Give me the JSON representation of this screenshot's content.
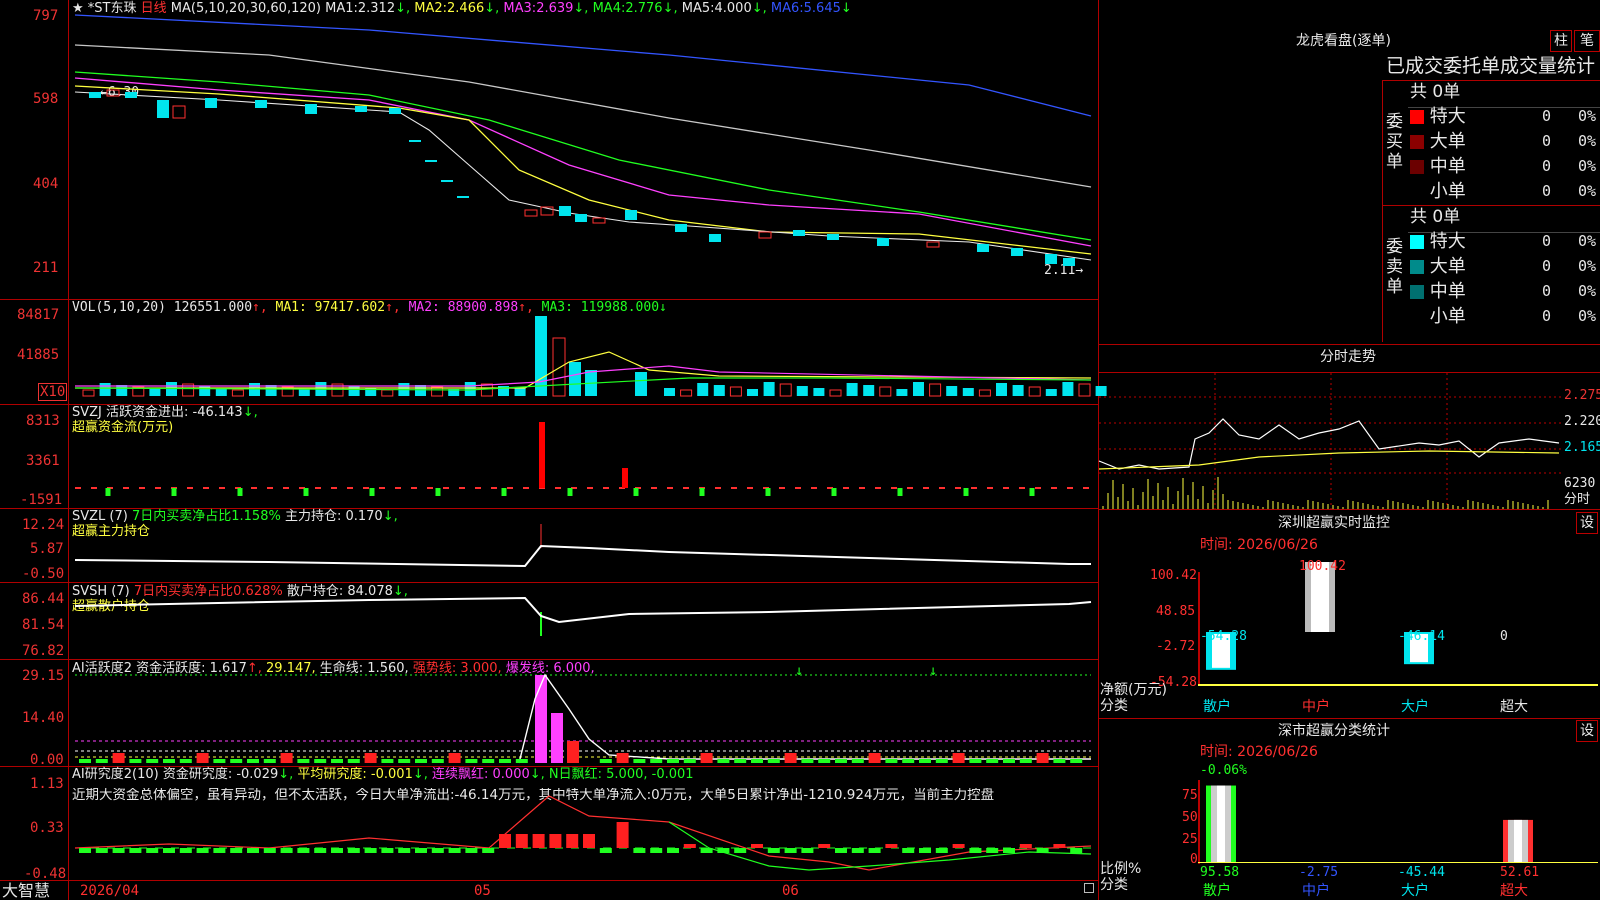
{
  "left_axis": {
    "price": [
      "797",
      "598",
      "404",
      "211"
    ],
    "vol": [
      "84817",
      "41885",
      "X10"
    ],
    "svzj": [
      "8313",
      "3361",
      "-1591"
    ],
    "svzl": [
      "12.24",
      "5.87",
      "-0.50"
    ],
    "svsh": [
      "86.44",
      "81.54",
      "76.82"
    ],
    "ai1": [
      "29.15",
      "14.40",
      "0.00"
    ],
    "ai2": [
      "1.13",
      "0.33",
      "-0.48"
    ]
  },
  "header": {
    "star": "★",
    "name": "*ST东珠",
    "period": "日线",
    "ma_label": "MA(5,10,20,30,60,120)",
    "ma": [
      {
        "label": "MA1:",
        "value": "2.312",
        "color": "#e8e8e8"
      },
      {
        "label": "MA2:",
        "value": "2.466",
        "color": "#ffff40"
      },
      {
        "label": "MA3:",
        "value": "2.639",
        "color": "#ff40ff"
      },
      {
        "label": "MA4:",
        "value": "2.776",
        "color": "#20ff20"
      },
      {
        "label": "MA5:",
        "value": "4.000",
        "color": "#e8e8e8"
      },
      {
        "label": "MA6:",
        "value": "5.645",
        "color": "#3355ff"
      }
    ],
    "high_mark": "6.30",
    "low_mark": "2.11"
  },
  "vol": {
    "label": "VOL(5,10,20)",
    "value": "126551.000",
    "ma1": "MA1: 97417.602",
    "ma2": "MA2: 88900.898",
    "ma3": "MA3: 119988.000"
  },
  "svzj": {
    "label": "SVZJ  活跃资金进出: -46.143",
    "sub": "超赢资金流(万元)"
  },
  "svzl": {
    "label": "SVZL (7)",
    "pct": "7日内买卖净占比1.158%",
    "hold": "主力持仓: 0.170",
    "sub": "超赢主力持仓"
  },
  "svsh": {
    "label": "SVSH (7)",
    "pct": "7日内买卖净占比0.628%",
    "hold": "散户持仓: 84.078",
    "sub": "超赢散户持仓"
  },
  "ai1": {
    "label": "AI活跃度2 资金活跃度: 1.617",
    "v2": "29.147,",
    "v3": "生命线: 1.560,",
    "v4": "强势线: 3.000,",
    "v5": "爆发线: 6.000,"
  },
  "ai2": {
    "label": "AI研究度2(10) 资金研究度: -0.029",
    "v2": "平均研究度: -0.001",
    "v3": "连续飘红: 0.000",
    "v4": "N日飘红: 5.000, -0.001",
    "text": "近期大资金总体偏空，虽有异动，但不太活跃，今日大单净流出:-46.14万元，其中特大单净流入:0万元，大单5日累计净出-1210.924万元，当前主力控盘"
  },
  "bottom": {
    "brand": "大智慧",
    "d1": "2026/04",
    "d2": "05",
    "d3": "06"
  },
  "right": {
    "title": "龙虎看盘(逐单)",
    "btn1": "柱",
    "btn2": "笔",
    "subtitle": "已成交委托单成交量统计",
    "buy_total": "共 0单",
    "sell_total": "共 0单",
    "buy_side": "委买单",
    "sell_side": "委卖单",
    "rows": [
      "特大",
      "大单",
      "中单",
      "小单"
    ],
    "zero": "0",
    "pct": "0%",
    "buy_colors": [
      "#ff0000",
      "#8b0000",
      "#6b0000",
      "#000000"
    ],
    "sell_colors": [
      "#00ffff",
      "#008b8b",
      "#007070",
      "#000000"
    ],
    "minute_title": "分时走势",
    "minute_prices": [
      "2.275",
      "2.220",
      "2.165"
    ],
    "minute_vol": "6230",
    "minute_unit": "分时",
    "monitor_title": "深圳超赢实时监控",
    "monitor_btn": "设",
    "monitor_time": "时间: 2026/06/26",
    "monitor_axis": [
      "100.42",
      "48.85",
      "-2.72",
      "-54.28"
    ],
    "monitor_vals": [
      "-54.28",
      "100.42",
      "-46.14",
      "0"
    ],
    "monitor_ylabel": "净额(万元)",
    "monitor_xlabel": "分类",
    "cats": [
      "散户",
      "中户",
      "大户",
      "超大"
    ],
    "stat_title": "深市超赢分类统计",
    "stat_btn": "设",
    "stat_time": "时间: 2026/06/26",
    "stat_top": "-0.06%",
    "stat_axis": [
      "75",
      "50",
      "25",
      "0"
    ],
    "stat_vals": [
      "95.58",
      "-2.75",
      "-45.44",
      "52.61"
    ],
    "stat_ylabel": "比例%",
    "stat_xlabel": "分类"
  },
  "chart_data": {
    "type": "bar",
    "title": "",
    "categories": [
      "散户",
      "中户",
      "大户",
      "超大"
    ],
    "series": [
      {
        "name": "净额(万元)",
        "values": [
          -54.28,
          100.42,
          -46.14,
          0
        ]
      },
      {
        "name": "比例%",
        "values": [
          95.58,
          -2.75,
          -45.44,
          52.61
        ]
      }
    ]
  }
}
